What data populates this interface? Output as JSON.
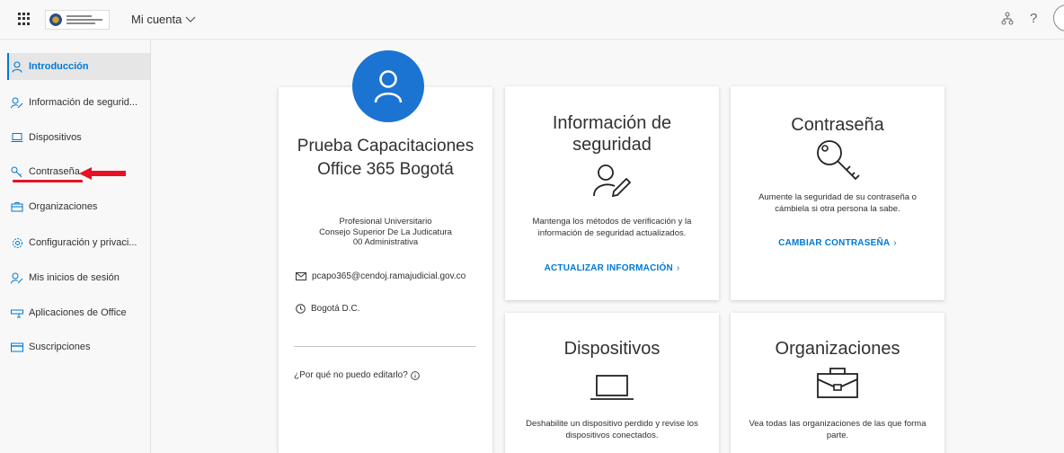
{
  "header": {
    "app_title": "Mi cuenta",
    "icons": [
      "waffle-icon",
      "org-chart-icon",
      "help-icon",
      "account-avatar"
    ],
    "help_label": "?"
  },
  "sidebar": {
    "items": [
      {
        "label": "Introducción",
        "icon": "person-icon",
        "active": true
      },
      {
        "label": "Información de segurid...",
        "icon": "person-key-icon"
      },
      {
        "label": "Dispositivos",
        "icon": "laptop-icon"
      },
      {
        "label": "Contraseña",
        "icon": "key-icon"
      },
      {
        "label": "Organizaciones",
        "icon": "briefcase-icon"
      },
      {
        "label": "Configuración y privaci...",
        "icon": "gear-icon"
      },
      {
        "label": "Mis inicios de sesión",
        "icon": "person-key-icon"
      },
      {
        "label": "Aplicaciones de Office",
        "icon": "apps-icon"
      },
      {
        "label": "Suscripciones",
        "icon": "card-icon"
      }
    ]
  },
  "profile": {
    "name": "Prueba Capacitaciones Office 365 Bogotá",
    "title": "Profesional Universitario",
    "department": "Consejo Superior De La Judicatura 00 Administrativa",
    "email": "pcapo365@cendoj.ramajudicial.gov.co",
    "location": "Bogotá D.C.",
    "why_cant_edit": "¿Por qué no puedo editarlo?"
  },
  "tiles": {
    "security": {
      "title": "Información de seguridad",
      "description": "Mantenga los métodos de verificación y la información de seguridad actualizados.",
      "link": "ACTUALIZAR INFORMACIÓN"
    },
    "password": {
      "title": "Contraseña",
      "description": "Aumente la seguridad de su contraseña o cámbiela si otra persona la sabe.",
      "link": "CAMBIAR CONTRASEÑA"
    },
    "devices": {
      "title": "Dispositivos",
      "description": "Deshabilite un dispositivo perdido y revise los dispositivos conectados."
    },
    "organizations": {
      "title": "Organizaciones",
      "description": "Vea todas las organizaciones de las que forma parte."
    }
  },
  "colors": {
    "accent": "#0078d4",
    "avatar": "#1b74d1",
    "annotation": "#e81123"
  }
}
